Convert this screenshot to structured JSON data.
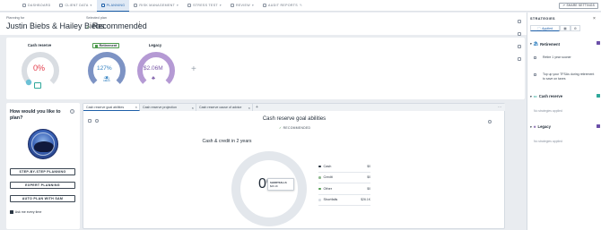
{
  "nav": {
    "items": [
      {
        "label": "DASHBOARD",
        "dropdown": false
      },
      {
        "label": "CLIENT DATA",
        "dropdown": true
      },
      {
        "label": "PLANNING",
        "dropdown": false,
        "active": true
      },
      {
        "label": "RISK MANAGEMENT",
        "dropdown": true
      },
      {
        "label": "STRESS TEST",
        "dropdown": true
      },
      {
        "label": "REVIEW",
        "dropdown": true
      },
      {
        "label": "AUDIT REPORTS",
        "dropdown": false
      }
    ],
    "share_label": "SHARE SETTINGS"
  },
  "header": {
    "planning_for_label": "Planning for",
    "client_name": "Justin Biebs & Hailey Biebs",
    "selected_plan_label": "Selected plan",
    "plan_name": "Recommended",
    "kebab": "⋮"
  },
  "cards": {
    "cash_reserve": {
      "title": "Cash reserve",
      "value": "0%",
      "pct": 0
    },
    "retirement": {
      "title": "Retirement",
      "value": "127%",
      "pct": 100
    },
    "legacy": {
      "title": "Legacy",
      "value": "$2.06M",
      "pct": 100
    },
    "add": "+"
  },
  "plan_panel": {
    "question": "How would you like to plan?",
    "help": "?",
    "buttons": [
      "STEP-BY-STEP PLANNING",
      "EXPERT PLANNING",
      "AUTO PLAN WITH SAM"
    ],
    "ask_label": "Ask me every time"
  },
  "goal_panel": {
    "tabs": [
      {
        "label": "Cash reserve goal abilities",
        "active": true
      },
      {
        "label": "Cash reserve projection",
        "active": false
      },
      {
        "label": "Cash reserve cause of advice",
        "active": false
      }
    ],
    "tab_add": "+",
    "tab_more": "⋯",
    "title": "Cash reserve goal abilities",
    "recommended_label": "RECOMMENDED",
    "section_title": "Cash & credit in 2 years",
    "donut_value": "0%",
    "tooltip": {
      "label": "SHORTFALLS",
      "value": "$26.1K"
    },
    "legend": [
      {
        "label": "Cash",
        "value": "$0",
        "color": "#1f2a36"
      },
      {
        "label": "Credit",
        "value": "$0",
        "color": "#8fb98f"
      },
      {
        "label": "Other",
        "value": "$0",
        "color": "#4c9a4c"
      },
      {
        "label": "Shortfalls",
        "value": "$26.1K",
        "color": "#d5dbe2"
      }
    ]
  },
  "strategies": {
    "title": "STRATEGIES",
    "close": "×",
    "tabs": [
      "Applied",
      "",
      ""
    ],
    "groups": [
      {
        "name": "Retirement",
        "color": "#6b4fa8",
        "options": [
          "Retire 1 year sooner",
          "Top up your TFSAs during retirement to save on taxes"
        ]
      },
      {
        "name": "Cash reserve",
        "color": "#2fa89a",
        "none": "No strategies applied"
      },
      {
        "name": "Legacy",
        "color": "#6b4fa8",
        "none": "No strategies applied"
      }
    ]
  },
  "colors": {
    "accent": "#1d5fa8",
    "shortfall": "#e23b4a",
    "retirement": "#2f7fc0",
    "legacy": "#7b5aa8"
  }
}
